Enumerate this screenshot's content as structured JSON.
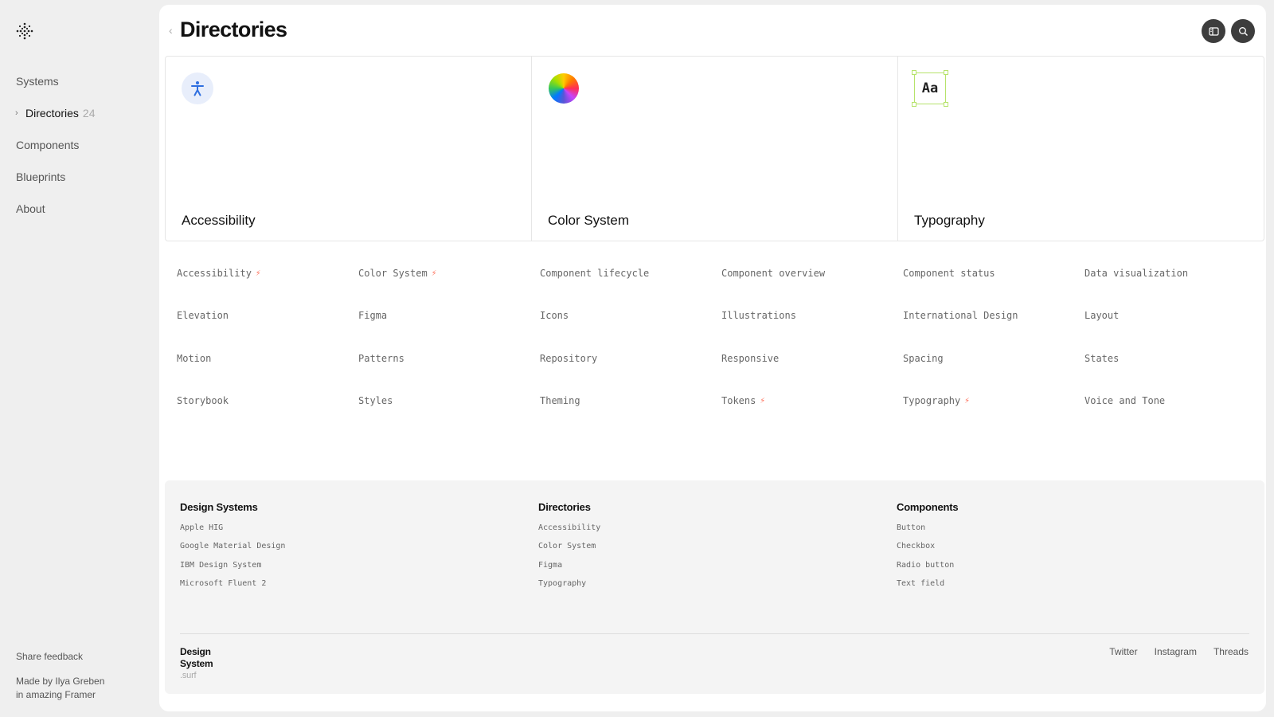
{
  "sidebar": {
    "logo_icon": "sparkle-dots-icon",
    "items": [
      {
        "label": "Systems",
        "active": false
      },
      {
        "label": "Directories",
        "active": true,
        "count": "24"
      },
      {
        "label": "Components",
        "active": false
      },
      {
        "label": "Blueprints",
        "active": false
      },
      {
        "label": "About",
        "active": false
      }
    ],
    "share_feedback": "Share feedback",
    "made_by_line1": "Made by Ilya Greben",
    "made_by_line2": "in amazing Framer"
  },
  "header": {
    "title": "Directories",
    "back_icon": "chevron-left-icon",
    "buttons": [
      "sidebar-toggle-icon",
      "search-icon"
    ]
  },
  "cards": [
    {
      "label": "Accessibility",
      "icon": "accessibility-icon"
    },
    {
      "label": "Color System",
      "icon": "color-wheel-icon"
    },
    {
      "label": "Typography",
      "icon": "typography-icon",
      "icon_text": "Aa"
    }
  ],
  "directories": [
    {
      "label": "Accessibility",
      "bolt": true
    },
    {
      "label": "Color System",
      "bolt": true
    },
    {
      "label": "Component lifecycle",
      "bolt": false
    },
    {
      "label": "Component overview",
      "bolt": false
    },
    {
      "label": "Component status",
      "bolt": false
    },
    {
      "label": "Data visualization",
      "bolt": false
    },
    {
      "label": "Elevation",
      "bolt": false
    },
    {
      "label": "Figma",
      "bolt": false
    },
    {
      "label": "Icons",
      "bolt": false
    },
    {
      "label": "Illustrations",
      "bolt": false
    },
    {
      "label": "International Design",
      "bolt": false
    },
    {
      "label": "Layout",
      "bolt": false
    },
    {
      "label": "Motion",
      "bolt": false
    },
    {
      "label": "Patterns",
      "bolt": false
    },
    {
      "label": "Repository",
      "bolt": false
    },
    {
      "label": "Responsive",
      "bolt": false
    },
    {
      "label": "Spacing",
      "bolt": false
    },
    {
      "label": "States",
      "bolt": false
    },
    {
      "label": "Storybook",
      "bolt": false
    },
    {
      "label": "Styles",
      "bolt": false
    },
    {
      "label": "Theming",
      "bolt": false
    },
    {
      "label": "Tokens",
      "bolt": true
    },
    {
      "label": "Typography",
      "bolt": true
    },
    {
      "label": "Voice and Tone",
      "bolt": false
    }
  ],
  "footer": {
    "columns": [
      {
        "heading": "Design Systems",
        "links": [
          "Apple HIG",
          "Google Material Design",
          "IBM Design System",
          "Microsoft Fluent 2"
        ]
      },
      {
        "heading": "Directories",
        "links": [
          "Accessibility",
          "Color System",
          "Figma",
          "Typography"
        ]
      },
      {
        "heading": "Components",
        "links": [
          "Button",
          "Checkbox",
          "Radio button",
          "Text field"
        ]
      }
    ],
    "brand_line1": "Design",
    "brand_line2": "System",
    "brand_suffix": ".surf",
    "social": [
      "Twitter",
      "Instagram",
      "Threads"
    ]
  },
  "colors": {
    "accent_bolt": "#ff7a3d",
    "accessibility_blue": "#2f6fe0",
    "typography_green": "#b6e36b",
    "button_dark": "#3d3d3d"
  }
}
